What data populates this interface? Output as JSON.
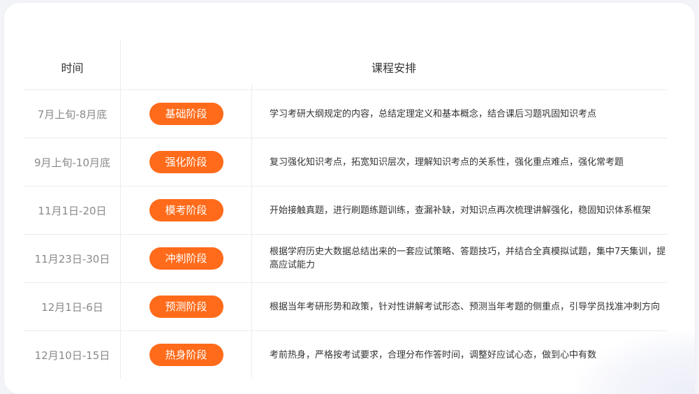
{
  "header": {
    "time_label": "时间",
    "arrangement_label": "课程安排"
  },
  "colors": {
    "accent": "#ff6b1a",
    "date_text": "#8a8a8a",
    "body_text": "#333333"
  },
  "rows": [
    {
      "date": "7月上旬-8月底",
      "stage": "基础阶段",
      "description": "学习考研大纲规定的内容，总结定理定义和基本概念，结合课后习题巩固知识考点"
    },
    {
      "date": "9月上旬-10月底",
      "stage": "强化阶段",
      "description": "复习强化知识考点，拓宽知识层次，理解知识考点的关系性，强化重点难点，强化常考题"
    },
    {
      "date": "11月1日-20日",
      "stage": "模考阶段",
      "description": "开始接触真题，进行刷题练题训练，查漏补缺，对知识点再次梳理讲解强化，稳固知识体系框架"
    },
    {
      "date": "11月23日-30日",
      "stage": "冲刺阶段",
      "description": "根据学府历史大数据总结出来的一套应试策略、答题技巧，并结合全真模拟试题，集中7天集训，提高应试能力"
    },
    {
      "date": "12月1日-6日",
      "stage": "预测阶段",
      "description": "根据当年考研形势和政策，针对性讲解考试形态、预测当年考题的侧重点，引导学员找准冲刺方向"
    },
    {
      "date": "12月10日-15日",
      "stage": "热身阶段",
      "description": "考前热身，严格按考试要求，合理分布作答时间，调整好应试心态，做到心中有数"
    }
  ]
}
